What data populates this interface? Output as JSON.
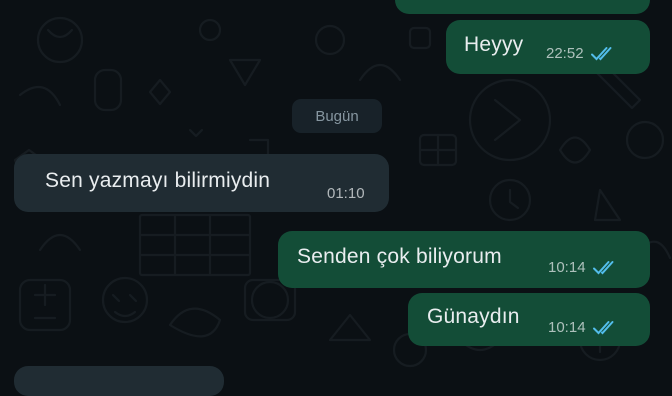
{
  "colors": {
    "background": "#0b1014",
    "outgoing_bubble": "#134d37",
    "incoming_bubble": "#202c33",
    "text": "#e9edef",
    "read_tick": "#53bdeb",
    "date_chip": "#182229"
  },
  "date_separator": "Bugün",
  "messages": [
    {
      "direction": "outgoing",
      "text": "Heyyy",
      "time": "22:52",
      "status": "read",
      "status_icon": "double-check-icon"
    },
    {
      "direction": "incoming",
      "text": "Sen yazmayı bilirmiydin",
      "time": "01:10"
    },
    {
      "direction": "outgoing",
      "text": "Senden çok biliyorum",
      "time": "10:14",
      "status": "read",
      "status_icon": "double-check-icon"
    },
    {
      "direction": "outgoing",
      "text": "Günaydın",
      "time": "10:14",
      "status": "read",
      "status_icon": "double-check-icon"
    }
  ]
}
